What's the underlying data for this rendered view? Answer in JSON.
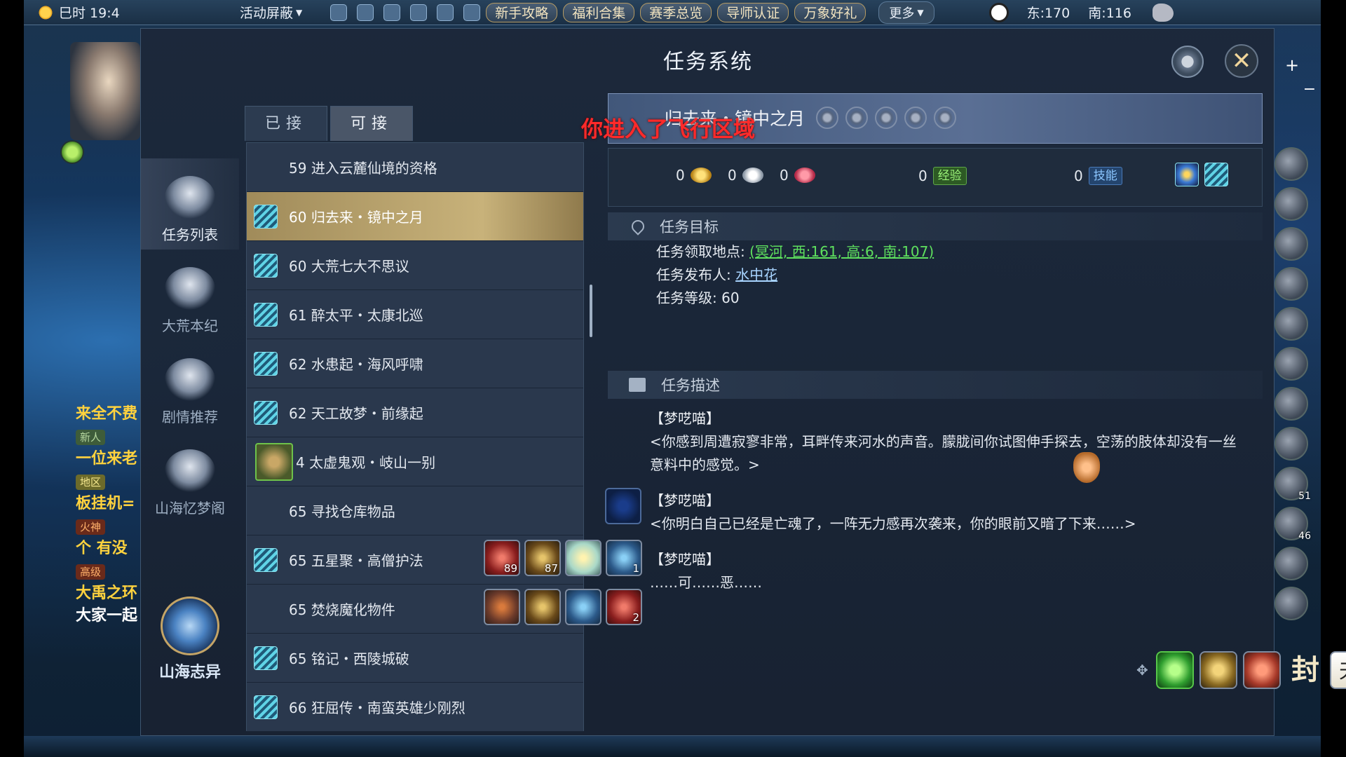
{
  "topbar": {
    "time": "巳时 19:4",
    "activity_block": "活动屏蔽",
    "buttons": [
      "新手攻略",
      "福利合集",
      "赛季总览",
      "导师认证",
      "万象好礼"
    ],
    "more": "更多",
    "coord_east": "东:170",
    "coord_south": "南:116"
  },
  "window": {
    "title": "任务系统",
    "close_glyph": "✕"
  },
  "nav": [
    {
      "label": "任务列表",
      "icon": "quest-list-icon"
    },
    {
      "label": "大荒本纪",
      "icon": "chronicle-icon"
    },
    {
      "label": "剧情推荐",
      "icon": "story-recommend-icon"
    },
    {
      "label": "山海忆梦阁",
      "icon": "pavilion-icon"
    }
  ],
  "nav_bottom": {
    "label": "山海志异",
    "icon": "shanhai-emblem-icon"
  },
  "tabs": [
    {
      "label": "已接"
    },
    {
      "label": "可接"
    }
  ],
  "quests": [
    {
      "level": "59",
      "name": "进入云麓仙境的资格"
    },
    {
      "level": "60",
      "name": "归去来・镜中之月"
    },
    {
      "level": "60",
      "name": "大荒七大不思议"
    },
    {
      "level": "61",
      "name": "醉太平・太康北巡"
    },
    {
      "level": "62",
      "name": "水患起・海风呼啸"
    },
    {
      "level": "62",
      "name": "天工故梦・前缘起"
    },
    {
      "level": "4",
      "name": "太虚鬼观・岐山一别"
    },
    {
      "level": "65",
      "name": "寻找仓库物品"
    },
    {
      "level": "65",
      "name": "五星聚・高僧护法"
    },
    {
      "level": "65",
      "name": "焚烧魔化物件"
    },
    {
      "level": "65",
      "name": "铭记・西陵城破"
    },
    {
      "level": "66",
      "name": "狂屈传・南蛮英雄少刚烈"
    }
  ],
  "quest_item_counts": {
    "row9": [
      "89",
      "87",
      "",
      "1"
    ],
    "row10": [
      "",
      "",
      "",
      "2"
    ]
  },
  "detail": {
    "title": "归去来・镜中之月",
    "star_count": 5,
    "flight_message": "你进入了飞行区域",
    "rewards": {
      "gold": "0",
      "silver": "0",
      "jade": "0",
      "exp_value": "0",
      "exp_label": "经验",
      "skill_value": "0",
      "skill_label": "技能"
    },
    "goal_section": "任务目标",
    "goal": {
      "location_label": "任务领取地点:",
      "location_value": "(冥河, 西:161, 高:6, 南:107)",
      "giver_label": "任务发布人:",
      "giver_value": "水中花",
      "level_label": "任务等级:",
      "level_value": "60"
    },
    "desc_section": "任务描述",
    "desc": [
      {
        "speaker": "【梦呓喵】",
        "text": "<你感到周遭寂寥非常，耳畔传来河水的声音。朦胧间你试图伸手探去，空荡的肢体却没有一丝意料中的感觉。>"
      },
      {
        "speaker": "【梦呓喵】",
        "text": "<你明白自己已经是亡魂了，一阵无力感再次袭来，你的眼前又暗了下来……>"
      },
      {
        "speaker": "【梦呓喵】",
        "text": "……可……恶……"
      }
    ]
  },
  "actions": {
    "seal": "封",
    "scroll": "天"
  },
  "chat": [
    {
      "text": "来全不费"
    },
    {
      "tag": "新人",
      "text": ""
    },
    {
      "text": "一位来老"
    },
    {
      "tag": "地区",
      "text": ""
    },
    {
      "text": "板挂机="
    },
    {
      "tag": "火神",
      "text": ""
    },
    {
      "text": "个 有没"
    },
    {
      "tag": "高级",
      "text": ""
    },
    {
      "text": "大禹之环"
    },
    {
      "text": "大家一起"
    }
  ],
  "right_hud_badges": [
    "51",
    "46"
  ]
}
